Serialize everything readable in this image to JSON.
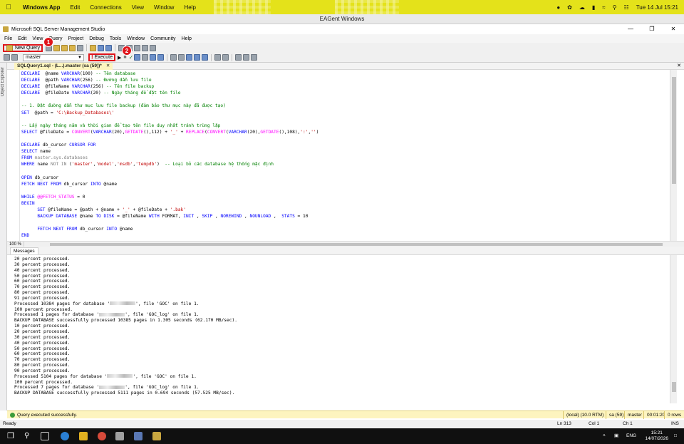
{
  "mac_menubar": {
    "app_name": "Windows App",
    "items": [
      "Edit",
      "Connections",
      "View",
      "Window",
      "Help"
    ],
    "date_time": "Tue 14 Jul  15:21"
  },
  "window_title": "EAGent Windows",
  "ssms": {
    "title": "Microsoft SQL Server Management Studio",
    "menu": [
      "File",
      "Edit",
      "View",
      "Query",
      "Project",
      "Debug",
      "Tools",
      "Window",
      "Community",
      "Help"
    ],
    "toolbar": {
      "new_query_label": "New Query",
      "database_selected": "master",
      "execute_label": "Execute"
    },
    "callouts": {
      "first": "1",
      "second": "2"
    },
    "object_explorer_label": "Object Explorer",
    "editor_tab": "SQLQuery1.sql - (L...).master (sa (59))*",
    "zoom": "100 %",
    "messages_tab": "Messages",
    "query_status": {
      "message": "Query executed successfully.",
      "server": "(local) (10.0 RTM)",
      "user": "sa (59)",
      "database": "master",
      "elapsed": "00:01:20",
      "rows": "0 rows"
    },
    "app_status": {
      "ready": "Ready",
      "line": "Ln 313",
      "col": "Col 1",
      "ch": "Ch 1",
      "mode": "INS"
    }
  },
  "sql_lines": [
    [
      [
        "kw",
        "DECLARE"
      ],
      [
        "",
        "  @name "
      ],
      [
        "kw",
        "VARCHAR"
      ],
      [
        "",
        "(100) "
      ],
      [
        "cm",
        "-- Tên database"
      ]
    ],
    [
      [
        "kw",
        "DECLARE"
      ],
      [
        "",
        "  @path "
      ],
      [
        "kw",
        "VARCHAR"
      ],
      [
        "",
        "(256) "
      ],
      [
        "cm",
        "-- Đường dẫn lưu file"
      ]
    ],
    [
      [
        "kw",
        "DECLARE"
      ],
      [
        "",
        "  @fileName "
      ],
      [
        "kw",
        "VARCHAR"
      ],
      [
        "",
        "(256) "
      ],
      [
        "cm",
        "-- Tên file backup"
      ]
    ],
    [
      [
        "kw",
        "DECLARE"
      ],
      [
        "",
        "  @fileDate "
      ],
      [
        "kw",
        "VARCHAR"
      ],
      [
        "",
        "(20) "
      ],
      [
        "cm",
        "-- Ngày tháng để đặt tên file"
      ]
    ],
    [],
    [
      [
        "cm",
        "-- 1. Đặt đường dẫn thư mục lưu file backup (đảm bảo thư mục này đã được tạo)"
      ]
    ],
    [
      [
        "kw",
        "SET"
      ],
      [
        "",
        "  @path = "
      ],
      [
        "st",
        "'C:\\Backup_Databases\\'"
      ]
    ],
    [],
    [
      [
        "cm",
        "-- Lấy ngày tháng năm và thời gian để tạo tên file duy nhất tránh trùng lặp"
      ]
    ],
    [
      [
        "kw",
        "SELECT"
      ],
      [
        "",
        " @fileDate = "
      ],
      [
        "fn",
        "CONVERT"
      ],
      [
        "",
        "("
      ],
      [
        "kw",
        "VARCHAR"
      ],
      [
        "",
        "(20),"
      ],
      [
        "fn",
        "GETDATE"
      ],
      [
        "",
        "(),112) + "
      ],
      [
        "st",
        "'_'"
      ],
      [
        "",
        " + "
      ],
      [
        "fn",
        "REPLACE"
      ],
      [
        "",
        "("
      ],
      [
        "fn",
        "CONVERT"
      ],
      [
        "",
        "("
      ],
      [
        "kw",
        "VARCHAR"
      ],
      [
        "",
        "(20),"
      ],
      [
        "fn",
        "GETDATE"
      ],
      [
        "",
        "(),108),"
      ],
      [
        "st",
        "':'"
      ],
      [
        "",
        ","
      ],
      [
        "st",
        "''"
      ],
      [
        "",
        ")"
      ]
    ],
    [],
    [
      [
        "kw",
        "DECLARE"
      ],
      [
        "",
        " db_cursor "
      ],
      [
        "kw",
        "CURSOR FOR"
      ]
    ],
    [
      [
        "kw",
        "SELECT"
      ],
      [
        "",
        " name"
      ]
    ],
    [
      [
        "kw",
        "FROM"
      ],
      [
        "gy",
        " master.sys.databases"
      ]
    ],
    [
      [
        "kw",
        "WHERE"
      ],
      [
        "",
        " name "
      ],
      [
        "gy",
        "NOT IN"
      ],
      [
        "",
        " ("
      ],
      [
        "st",
        "'master'"
      ],
      [
        "",
        ","
      ],
      [
        "st",
        "'model'"
      ],
      [
        "",
        ","
      ],
      [
        "st",
        "'msdb'"
      ],
      [
        "",
        ","
      ],
      [
        "st",
        "'tempdb'"
      ],
      [
        "",
        ")  "
      ],
      [
        "cm",
        "-- Loại bỏ các database hệ thống mặc định"
      ]
    ],
    [],
    [
      [
        "kw",
        "OPEN"
      ],
      [
        "",
        " db_cursor"
      ]
    ],
    [
      [
        "kw",
        "FETCH NEXT FROM"
      ],
      [
        "",
        " db_cursor "
      ],
      [
        "kw",
        "INTO"
      ],
      [
        "",
        " @name"
      ]
    ],
    [],
    [
      [
        "kw",
        "WHILE"
      ],
      [
        "",
        " "
      ],
      [
        "fn",
        "@@FETCH_STATUS"
      ],
      [
        "",
        " = 0"
      ]
    ],
    [
      [
        "kw",
        "BEGIN"
      ]
    ],
    [
      [
        "",
        "      "
      ],
      [
        "kw",
        "SET"
      ],
      [
        "",
        " @fileName = @path + @name + "
      ],
      [
        "st",
        "'_'"
      ],
      [
        "",
        " + @fileDate + "
      ],
      [
        "st",
        "'.bak'"
      ]
    ],
    [
      [
        "",
        "      "
      ],
      [
        "kw",
        "BACKUP DATABASE"
      ],
      [
        "",
        " @name "
      ],
      [
        "kw",
        "TO DISK"
      ],
      [
        "",
        " = @fileName "
      ],
      [
        "kw",
        "WITH"
      ],
      [
        "",
        " FORMAT, "
      ],
      [
        "kw",
        "INIT"
      ],
      [
        "",
        " , "
      ],
      [
        "kw",
        "SKIP"
      ],
      [
        "",
        " , "
      ],
      [
        "kw",
        "NOREWIND"
      ],
      [
        "",
        " , "
      ],
      [
        "kw",
        "NOUNLOAD"
      ],
      [
        "",
        " ,  "
      ],
      [
        "kw",
        "STATS"
      ],
      [
        "",
        " = 10"
      ]
    ],
    [],
    [
      [
        "",
        "      "
      ],
      [
        "kw",
        "FETCH NEXT FROM"
      ],
      [
        "",
        " db_cursor "
      ],
      [
        "kw",
        "INTO"
      ],
      [
        "",
        " @name"
      ]
    ],
    [
      [
        "kw",
        "END"
      ]
    ]
  ],
  "message_lines": [
    "20 percent processed.",
    "30 percent processed.",
    "40 percent processed.",
    "50 percent processed.",
    "60 percent processed.",
    "70 percent processed.",
    "80 percent processed.",
    "91 percent processed.",
    "Processed 10384 pages for database '[redacted]', file 'GOC' on file 1.",
    "100 percent processed.",
    "Processed 1 pages for database '[redacted]', file 'GOC_log' on file 1.",
    "BACKUP DATABASE successfully processed 10385 pages in 1.305 seconds (62.170 MB/sec).",
    "10 percent processed.",
    "20 percent processed.",
    "30 percent processed.",
    "40 percent processed.",
    "50 percent processed.",
    "60 percent processed.",
    "70 percent processed.",
    "80 percent processed.",
    "90 percent processed.",
    "Processed 5104 pages for database '[redacted]', file 'GOC' on file 1.",
    "100 percent processed.",
    "Processed 7 pages for database '[redacted]', file 'GOC_log' on file 1.",
    "BACKUP DATABASE successfully processed 5111 pages in 0.694 seconds (57.525 MB/sec)."
  ],
  "taskbar": {
    "lang": "ENG",
    "time": "15:21",
    "date": "14/07/2026"
  },
  "colors": {
    "mac_bar": "#e4e21a",
    "highlight": "#e0141b",
    "status_bar": "#fdf4bf"
  }
}
